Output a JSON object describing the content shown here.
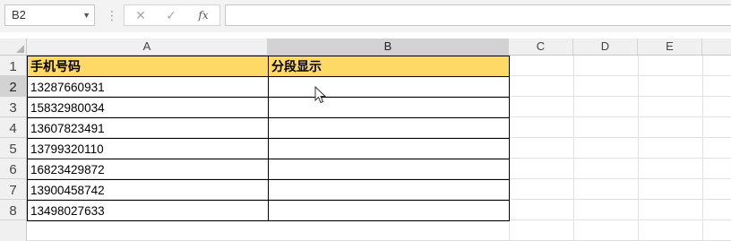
{
  "name_box": {
    "value": "B2"
  },
  "formula_bar": {
    "value": "",
    "fx_label": "fx"
  },
  "columns": [
    "A",
    "B",
    "C",
    "D",
    "E"
  ],
  "rows": [
    "1",
    "2",
    "3",
    "4",
    "5",
    "6",
    "7",
    "8"
  ],
  "table": {
    "headers": [
      "手机号码",
      "分段显示"
    ],
    "rows": [
      [
        "13287660931",
        ""
      ],
      [
        "15832980034",
        ""
      ],
      [
        "13607823491",
        ""
      ],
      [
        "13799320110",
        ""
      ],
      [
        "16823429872",
        ""
      ],
      [
        "13900458742",
        ""
      ],
      [
        "13498027633",
        ""
      ]
    ]
  },
  "colors": {
    "header_fill": "#ffd966",
    "grid_line": "#e1e1e1",
    "border": "#000000"
  }
}
